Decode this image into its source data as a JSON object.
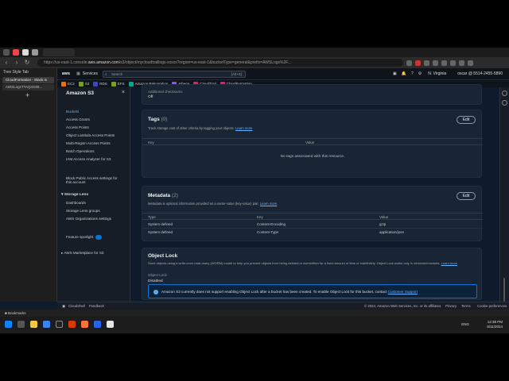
{
  "browser": {
    "vertical_tabs_title": "Tree Style Tab",
    "tab_label": "CloudFormation - Stack m",
    "side_items": [
      "AWSLogsTTAQ4S3B..."
    ],
    "url_prefix": "https://us-east-1.console.",
    "url_domain": "aws.amazon.com",
    "url_rest": "/s3/object/mycloudtraillogs-xxxxx?region=us-east-1&bucketType=general&prefix=AWSLogs%2F..."
  },
  "aws_header": {
    "logo": "aws",
    "services_label": "Services",
    "search_placeholder": "Search",
    "search_shortcut": "[Alt+S]",
    "region": "N. Virginia",
    "account": "oscar @ 5514-2455-5890"
  },
  "favorites": [
    {
      "label": "EC2",
      "color": "#ed7100"
    },
    {
      "label": "S3",
      "color": "#7aa116"
    },
    {
      "label": "RDS",
      "color": "#3b48cc"
    },
    {
      "label": "EFS",
      "color": "#7aa116"
    },
    {
      "label": "Amazon Rekognition",
      "color": "#01a88d"
    },
    {
      "label": "Athena",
      "color": "#8c4fff"
    },
    {
      "label": "CloudTrail",
      "color": "#e7157b"
    },
    {
      "label": "CloudFormation",
      "color": "#e7157b"
    }
  ],
  "s3_nav": {
    "title": "Amazon S3",
    "items": [
      {
        "label": "Buckets",
        "active": true
      },
      {
        "label": "Access Grants"
      },
      {
        "label": "Access Points"
      },
      {
        "label": "Object Lambda Access Points"
      },
      {
        "label": "Multi-Region Access Points"
      },
      {
        "label": "Batch Operations"
      },
      {
        "label": "IAM Access Analyzer for S3"
      }
    ],
    "block_public_1": "Block Public Access settings for",
    "block_public_2": "this account",
    "storage_lens": "Storage Lens",
    "lens_items": [
      "Dashboards",
      "Storage Lens groups",
      "AWS Organizations settings"
    ],
    "feature_spotlight": "Feature spotlight",
    "marketplace": "AWS Marketplace for S3"
  },
  "checksum": {
    "label": "Additional checksums",
    "value": "Off"
  },
  "tags": {
    "title": "Tags",
    "count": "(0)",
    "desc": "Track storage cost of other criteria by tagging your objects.",
    "learn_more": "Learn more",
    "edit": "Edit",
    "col_key": "Key",
    "col_value": "Value",
    "empty": "No tags associated with this resource."
  },
  "metadata": {
    "title": "Metadata",
    "count": "(2)",
    "desc": "Metadata is optional information provided as a name-value (key-value) pair.",
    "learn_more": "Learn more",
    "edit": "Edit",
    "col_type": "Type",
    "col_key": "Key",
    "col_value": "Value",
    "rows": [
      {
        "type": "System defined",
        "key": "Content-Encoding",
        "value": "gzip"
      },
      {
        "type": "System defined",
        "key": "Content-Type",
        "value": "application/json"
      }
    ]
  },
  "object_lock": {
    "title": "Object Lock",
    "desc": "Store objects using a write-once-read-many (WORM) model to help you prevent objects from being deleted or overwritten for a fixed amount of time or indefinitely. Object Lock works only in versioned buckets.",
    "learn_more": "Learn more",
    "label": "Object Lock",
    "value": "Disabled",
    "info": "Amazon S3 currently does not support enabling Object Lock after a bucket has been created. To enable Object Lock for this bucket, contact",
    "support_link": "Customer Support"
  },
  "footer": {
    "cloudshell": "CloudShell",
    "feedback": "Feedback",
    "copyright": "© 2024, Amazon Web Services, Inc. or its affiliates.",
    "privacy": "Privacy",
    "terms": "Terms",
    "cookie": "Cookie preferences"
  },
  "taskbar": {
    "bookmarks": "Bookmarks",
    "lang": "ENG",
    "time": "12:38 PM",
    "date": "6/11/2024"
  }
}
